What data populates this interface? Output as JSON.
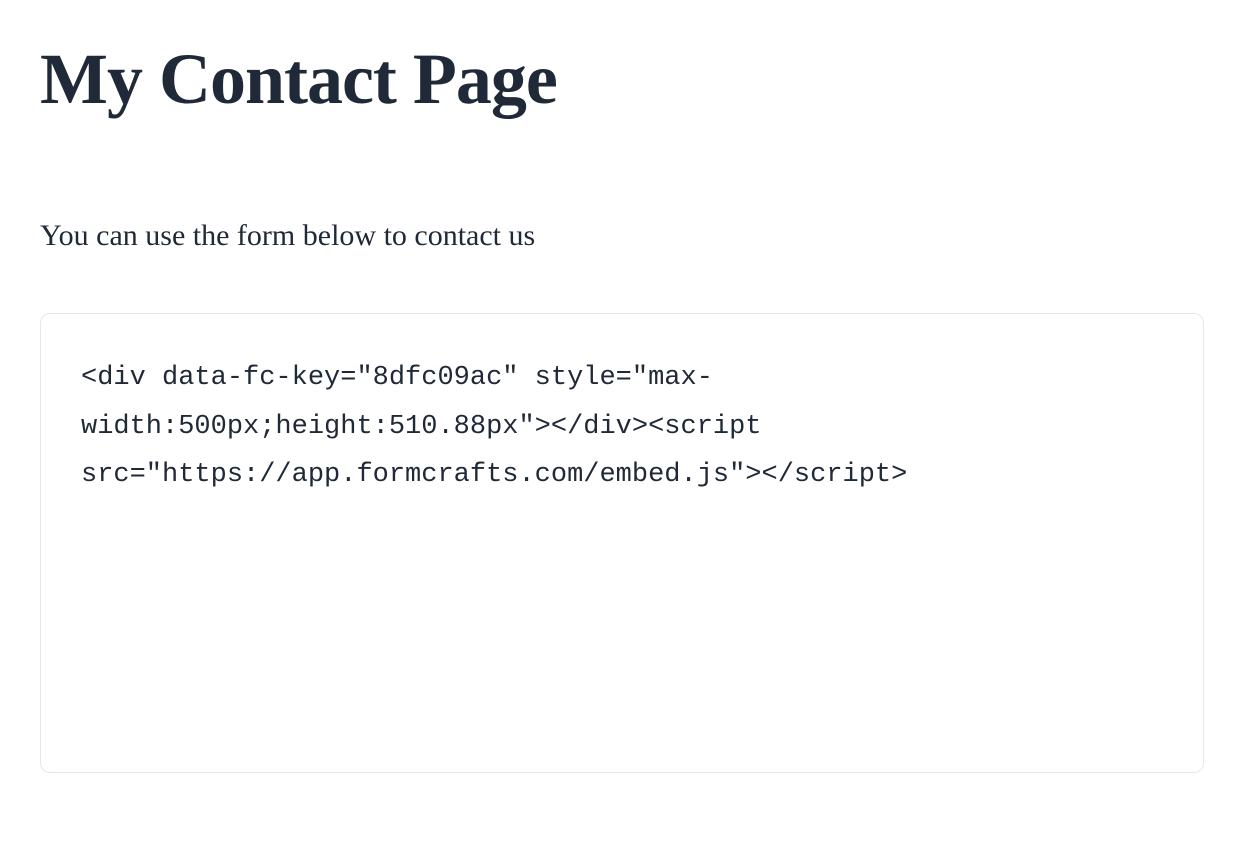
{
  "header": {
    "title": "My Contact Page"
  },
  "main": {
    "intro": "You can use the form below to contact us",
    "code": "<div data-fc-key=\"8dfc09ac\" style=\"max-width:500px;height:510.88px\"></div><script src=\"https://app.formcrafts.com/embed.js\"></script>"
  }
}
